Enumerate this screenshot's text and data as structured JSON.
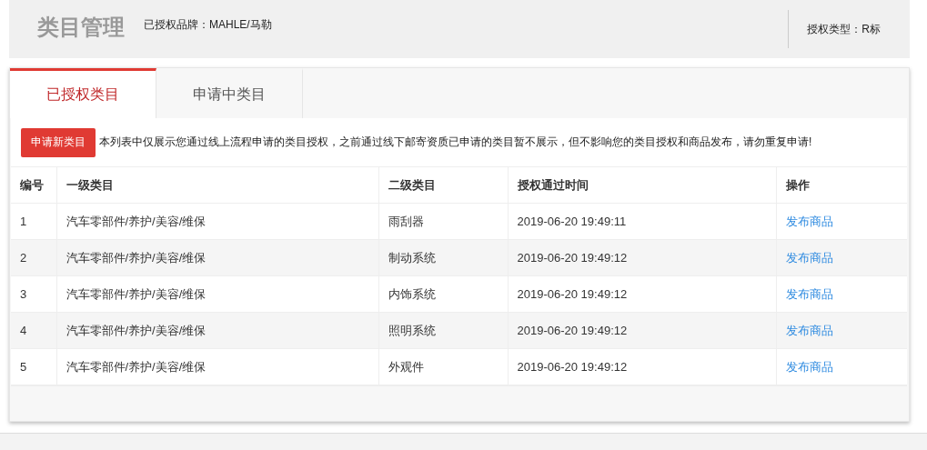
{
  "header": {
    "title": "类目管理",
    "brand": "已授权品牌：MAHLE/马勒",
    "auth_type": "授权类型：R标"
  },
  "tabs": [
    {
      "label": "已授权类目",
      "selected": true
    },
    {
      "label": "申请中类目",
      "selected": false
    }
  ],
  "apply_button": "申请新类目",
  "notice": "本列表中仅展示您通过线上流程申请的类目授权，之前通过线下邮寄资质已申请的类目暂不展示，但不影响您的类目授权和商品发布，请勿重复申请!",
  "table": {
    "columns": [
      "编号",
      "一级类目",
      "二级类目",
      "授权通过时间",
      "操作"
    ],
    "rows": [
      {
        "no": "1",
        "cat1": "汽车零部件/养护/美容/维保",
        "cat2": "雨刮器",
        "time": "2019-06-20 19:49:11",
        "action": "发布商品"
      },
      {
        "no": "2",
        "cat1": "汽车零部件/养护/美容/维保",
        "cat2": "制动系统",
        "time": "2019-06-20 19:49:12",
        "action": "发布商品"
      },
      {
        "no": "3",
        "cat1": "汽车零部件/养护/美容/维保",
        "cat2": "内饰系统",
        "time": "2019-06-20 19:49:12",
        "action": "发布商品"
      },
      {
        "no": "4",
        "cat1": "汽车零部件/养护/美容/维保",
        "cat2": "照明系统",
        "time": "2019-06-20 19:49:12",
        "action": "发布商品"
      },
      {
        "no": "5",
        "cat1": "汽车零部件/养护/美容/维保",
        "cat2": "外观件",
        "time": "2019-06-20 19:49:12",
        "action": "发布商品"
      }
    ]
  }
}
